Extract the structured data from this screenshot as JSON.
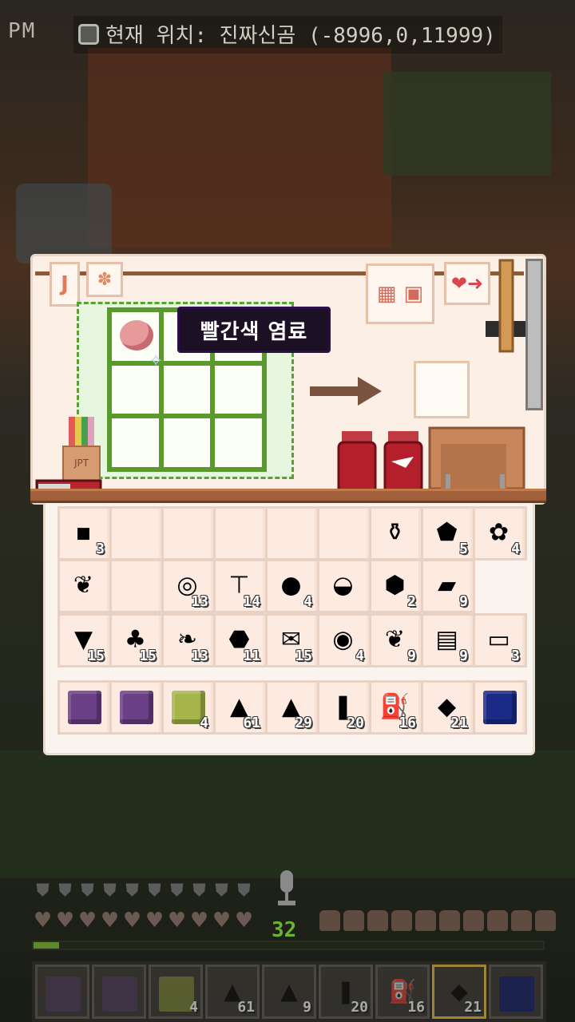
{
  "top_bar": {
    "time_suffix": "PM",
    "location_text": "현재 위치: 진짜신곰 (-8996,0,11999)",
    "icon": "clock-icon"
  },
  "crafting_panel": {
    "tooltip": "빨간색 염료",
    "note_left_label": "J",
    "note_paw_icon": "paw-icon",
    "note_right_icon": "heart-arrow-icon",
    "grid_items": [
      "raw-meat-icon",
      "",
      "",
      "",
      "",
      "",
      "",
      "",
      ""
    ],
    "output_slot": "",
    "pencup_label": "JPT"
  },
  "inventory": {
    "rows": [
      [
        {
          "icon": "small-stone-icon",
          "glyph": "▪",
          "count": "3"
        },
        {
          "icon": "",
          "glyph": "",
          "count": ""
        },
        {
          "icon": "",
          "glyph": "",
          "count": ""
        },
        {
          "icon": "",
          "glyph": "",
          "count": ""
        },
        {
          "icon": "",
          "glyph": "",
          "count": ""
        },
        {
          "icon": "",
          "glyph": "",
          "count": ""
        },
        {
          "icon": "empty-bottle-icon",
          "glyph": "⚱",
          "count": ""
        },
        {
          "icon": "iron-ore-icon",
          "glyph": "⬟",
          "count": "5"
        },
        {
          "icon": "berries-icon",
          "glyph": "✿",
          "count": "4"
        }
      ],
      [
        {
          "icon": "feather-icon",
          "glyph": "❦",
          "count": ""
        },
        {
          "icon": "",
          "glyph": "",
          "count": ""
        },
        {
          "icon": "tape-roll-icon",
          "glyph": "◎",
          "count": "13"
        },
        {
          "icon": "nail-icon",
          "glyph": "⊤",
          "count": "14"
        },
        {
          "icon": "pearl-icon",
          "glyph": "●",
          "count": "4"
        },
        {
          "icon": "coconut-bowl-icon",
          "glyph": "◒",
          "count": ""
        },
        {
          "icon": "coal-lump-icon",
          "glyph": "⬢",
          "count": "2"
        },
        {
          "icon": "iron-ingot-icon",
          "glyph": "▰",
          "count": "9"
        }
      ],
      [
        {
          "icon": "bucket-icon",
          "glyph": "▼",
          "count": "15"
        },
        {
          "icon": "olive-oil-icon",
          "glyph": "♣",
          "count": "15"
        },
        {
          "icon": "leaf-roll-icon",
          "glyph": "❧",
          "count": "13"
        },
        {
          "icon": "coal-icon",
          "glyph": "⬣",
          "count": "11"
        },
        {
          "icon": "envelope-icon",
          "glyph": "✉",
          "count": "15"
        },
        {
          "icon": "orange-slice-icon",
          "glyph": "◉",
          "count": "4"
        },
        {
          "icon": "green-leaf-icon",
          "glyph": "❦",
          "count": "9"
        },
        {
          "icon": "wood-crate-icon",
          "glyph": "▤",
          "count": "9"
        },
        {
          "icon": "ticket-icon",
          "glyph": "▭",
          "count": "3"
        }
      ],
      [
        {
          "icon": "purple-block-icon",
          "glyph": "",
          "count": "",
          "color": "#6a3f86"
        },
        {
          "icon": "purple-block-icon",
          "glyph": "",
          "count": "",
          "color": "#6a3f86"
        },
        {
          "icon": "sponge-block-icon",
          "glyph": "",
          "count": "4",
          "color": "#a6b54a"
        },
        {
          "icon": "white-powder-icon",
          "glyph": "▲",
          "count": "61"
        },
        {
          "icon": "black-powder-icon",
          "glyph": "▲",
          "count": "29"
        },
        {
          "icon": "brown-logs-icon",
          "glyph": "❚",
          "count": "20"
        },
        {
          "icon": "water-bottle-icon",
          "glyph": "⛽",
          "count": "16"
        },
        {
          "icon": "silver-sheet-icon",
          "glyph": "◆",
          "count": "21"
        },
        {
          "icon": "blue-block-icon",
          "glyph": "",
          "count": "",
          "color": "#1a2a86"
        }
      ]
    ]
  },
  "hud": {
    "level": "32",
    "xp_fraction": 0.05,
    "hearts": 10,
    "armor": 10,
    "food": 10,
    "hotbar": [
      {
        "icon": "purple-block-icon",
        "count": "",
        "color": "#4a3a55"
      },
      {
        "icon": "purple-block-icon",
        "count": "",
        "color": "#4a3a55"
      },
      {
        "icon": "sponge-block-icon",
        "count": "4",
        "color": "#6b7338"
      },
      {
        "icon": "white-powder-icon",
        "count": "61",
        "glyph": "▲"
      },
      {
        "icon": "black-powder-icon",
        "count": "9",
        "glyph": "▲"
      },
      {
        "icon": "brown-logs-icon",
        "count": "20",
        "glyph": "❚"
      },
      {
        "icon": "water-bottle-icon",
        "count": "16",
        "glyph": "⛽"
      },
      {
        "icon": "silver-sheet-icon",
        "count": "21",
        "glyph": "◆",
        "selected": true
      },
      {
        "icon": "blue-block-icon",
        "count": "",
        "color": "#1c2460"
      }
    ]
  }
}
